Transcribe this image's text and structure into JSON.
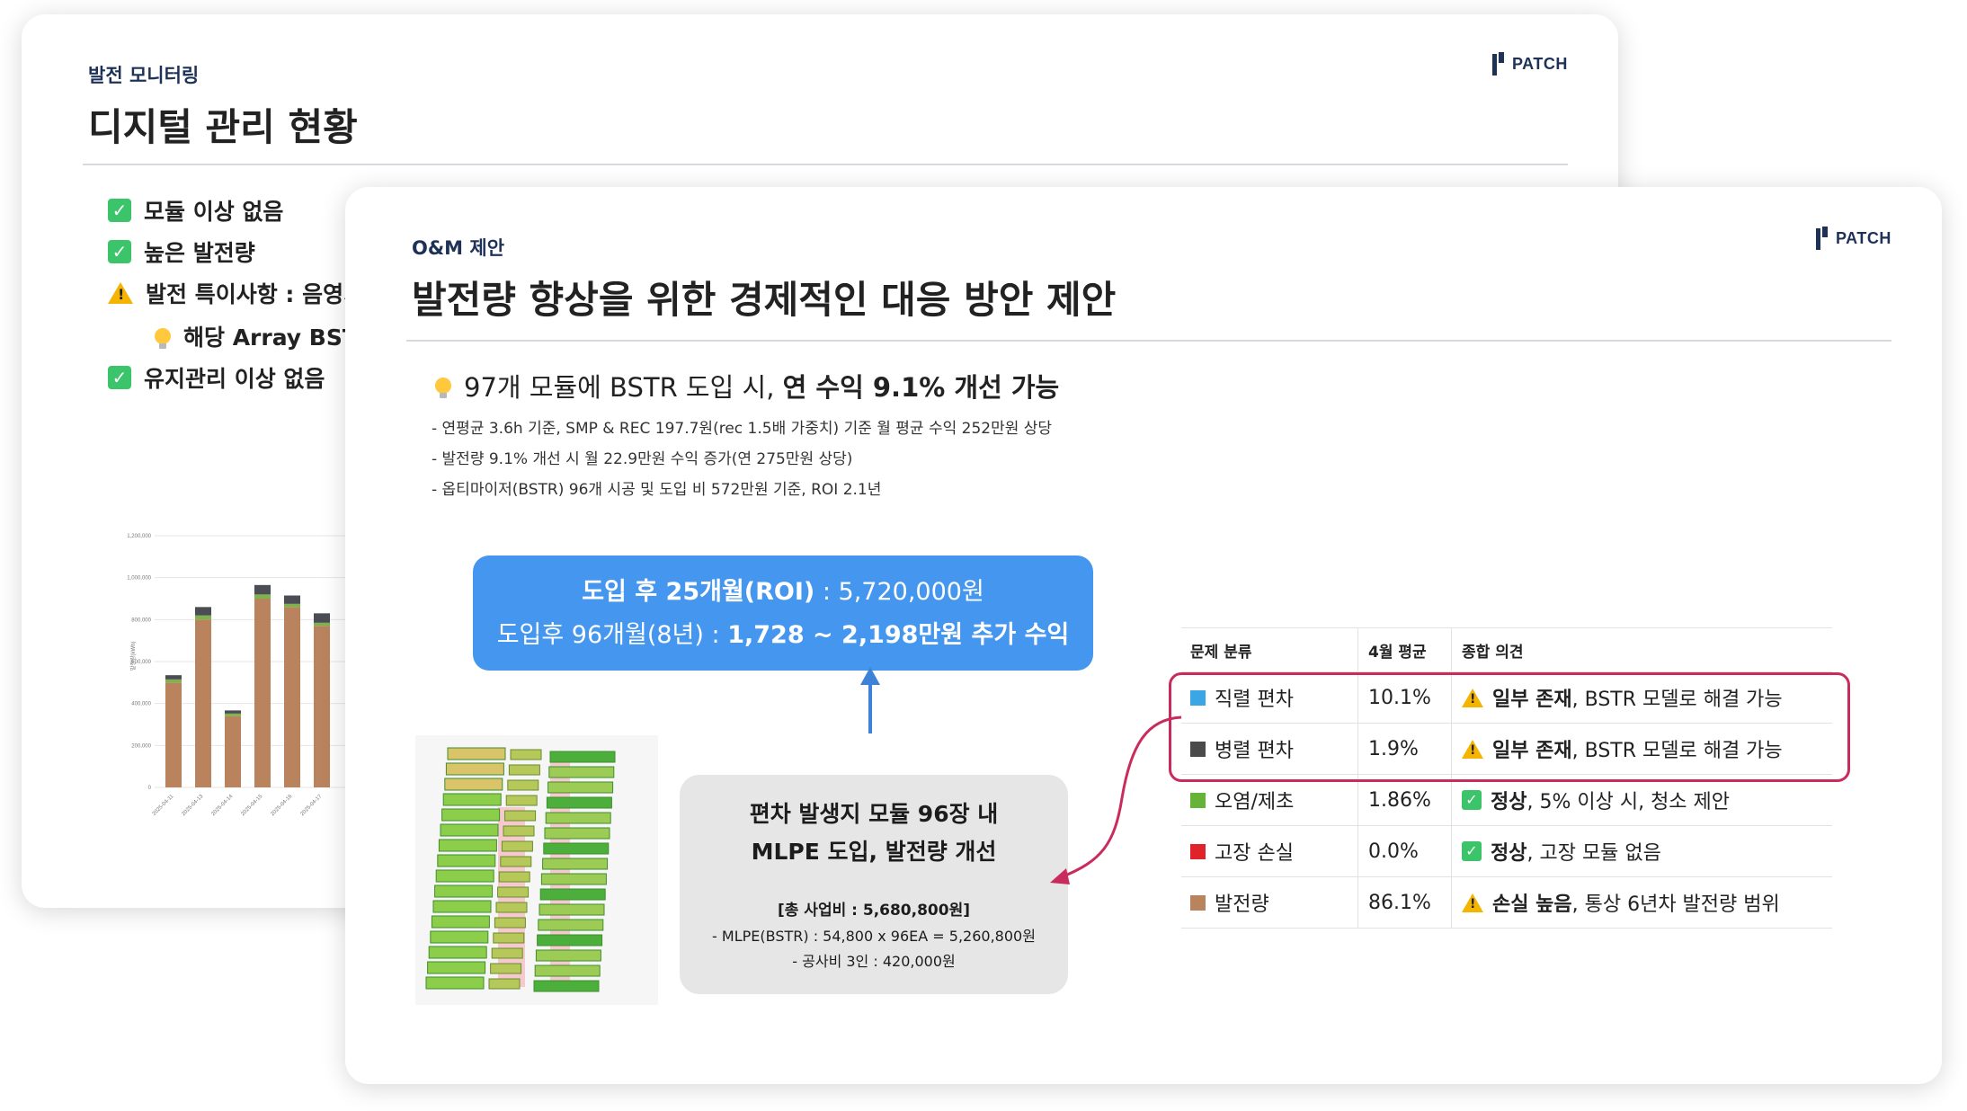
{
  "back_slide": {
    "logo": "PATCH",
    "subtitle": "발전 모니터링",
    "title": "디지털 관리 현황",
    "bullets": [
      {
        "icon": "check-icon",
        "text": "모듈 이상 없음"
      },
      {
        "icon": "check-icon",
        "text": "높은 발전량"
      },
      {
        "icon": "warning-icon",
        "text": "발전 특이사항 : 음영기"
      },
      {
        "icon": "lightbulb-icon",
        "text": "해당 Array BST"
      },
      {
        "icon": "check-icon",
        "text": "유지관리 이상 없음"
      }
    ],
    "chart_data": {
      "type": "bar",
      "title": "",
      "ylabel": "발전량(kWh)",
      "ylim": [
        0,
        1200000
      ],
      "yticks": [
        "0",
        "200,000",
        "400,000",
        "600,000",
        "800,000",
        "1,000,000",
        "1,200,000"
      ],
      "categories": [
        "2025-04-11",
        "2025-04-12",
        "2025-04-13",
        "2025-04-14",
        "2025-04-15",
        "2025-04-16",
        "2025-04-17"
      ],
      "x_tick_labels": [
        "2025-04-11",
        "2025-04-13",
        "2025-04-14",
        "2025-04-15",
        "2025-04-16",
        "2025-04-17"
      ],
      "series": [
        {
          "color": "#b9835d",
          "values": [
            500000,
            800000,
            340000,
            900000,
            860000,
            770000,
            0
          ]
        },
        {
          "color": "#7db34a",
          "values": [
            15000,
            20000,
            12000,
            20000,
            15000,
            15000,
            0
          ]
        },
        {
          "color": "#4a4d54",
          "values": [
            20000,
            40000,
            15000,
            45000,
            40000,
            45000,
            0
          ]
        }
      ]
    }
  },
  "front_slide": {
    "logo": "PATCH",
    "subtitle": "O&M 제안",
    "title": "발전량 향상을 위한 경제적인 대응 방안 제안",
    "tip_normal": "97개 모듈에 BSTR 도입 시, ",
    "tip_bold": "연 수익 9.1% 개선 가능",
    "notes": [
      "- 연평균 3.6h 기준, SMP & REC 197.7원(rec 1.5배 가중치) 기준 월 평균 수익 252만원 상당",
      "- 발전량 9.1% 개선 시 월 22.9만원 수익 증가(연 275만원 상당)",
      "- 옵티마이저(BSTR) 96개 시공 및 도입 비 572만원 기준, ROI 2.1년"
    ],
    "roi_box": {
      "line1_bold": "도입 후 25개월(ROI)",
      "line1_normal": " : 5,720,000원",
      "line2_normal": "도입후 96개월(8년) : ",
      "line2_bold": "1,728 ~ 2,198만원 추가 수익"
    },
    "proposal_box": {
      "title1": "편차 발생지 모듈 96장 내",
      "title2": "MLPE 도입, 발전량 개선",
      "cost_title": "[총 사업비 : 5,680,800원]",
      "cost1": "- MLPE(BSTR) : 54,800 x 96EA = 5,260,800원",
      "cost2": "- 공사비 3인 : 420,000원"
    },
    "table": {
      "headers": [
        "문제 분류",
        "4월 평균",
        "종합 의견"
      ],
      "rows": [
        {
          "color": "#3aa6e6",
          "category": "직렬 편차",
          "value": "10.1%",
          "icon": "warning-icon",
          "status": "일부 존재",
          "comment": ", BSTR 모델로 해결 가능"
        },
        {
          "color": "#4a4a4a",
          "category": "병렬 편차",
          "value": "1.9%",
          "icon": "warning-icon",
          "status": "일부 존재",
          "comment": ", BSTR 모델로 해결 가능"
        },
        {
          "color": "#66b33a",
          "category": "오염/제초",
          "value": "1.86%",
          "icon": "check-icon",
          "status": "정상",
          "comment": ", 5% 이상 시, 청소 제안"
        },
        {
          "color": "#e0232a",
          "category": "고장 손실",
          "value": "0.0%",
          "icon": "check-icon",
          "status": "정상",
          "comment": ", 고장 모듈 없음"
        },
        {
          "color": "#b9835d",
          "category": "발전량",
          "value": "86.1%",
          "icon": "warning-icon",
          "status": "손실 높음",
          "comment": ", 통상 6년차 발전량 범위"
        }
      ]
    }
  }
}
